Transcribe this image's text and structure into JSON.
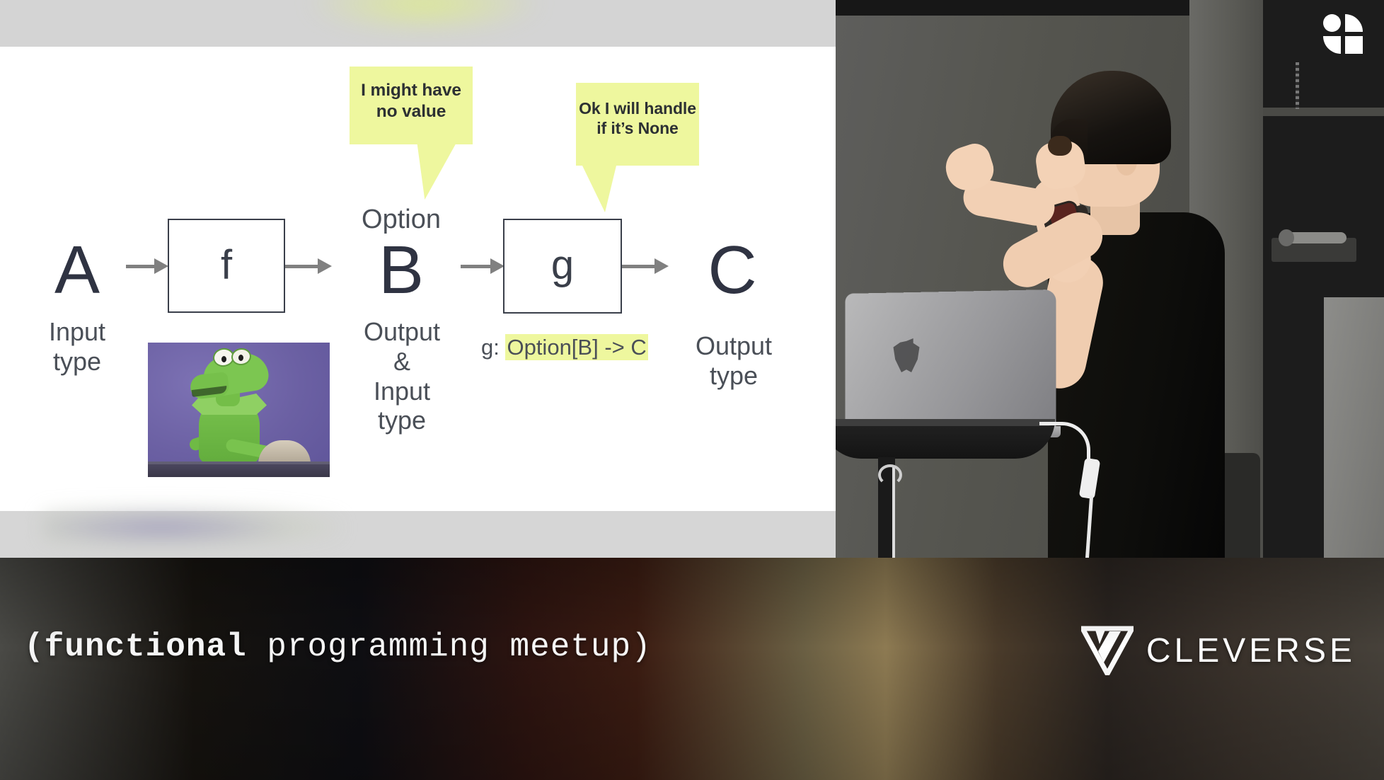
{
  "slide": {
    "bubbles": [
      {
        "id": "bubble-left",
        "text": "I might have no value"
      },
      {
        "id": "bubble-right",
        "text": "Ok I will handle if it’s None"
      }
    ],
    "diagram": {
      "type": "flow",
      "nodes": [
        {
          "id": "A",
          "label": "A",
          "kind": "type",
          "caption": "Input type"
        },
        {
          "id": "f",
          "label": "f",
          "kind": "process",
          "caption": ""
        },
        {
          "id": "B",
          "label": "B",
          "kind": "type",
          "caption": "Output & Input type",
          "prefix": "Option"
        },
        {
          "id": "g",
          "label": "g",
          "kind": "process",
          "caption": ""
        },
        {
          "id": "C",
          "label": "C",
          "kind": "type",
          "caption": "Output type"
        }
      ],
      "edges": [
        {
          "from": "A",
          "to": "f"
        },
        {
          "from": "f",
          "to": "B"
        },
        {
          "from": "B",
          "to": "g"
        },
        {
          "from": "g",
          "to": "C"
        }
      ],
      "captions": {
        "input_type": "Input type",
        "option_prefix": "Option",
        "middle_type": "Output\n&\nInput\ntype",
        "middle_line1": "Output",
        "middle_line2": "&",
        "middle_line3": "Input",
        "middle_line4": "type",
        "output_type": "Output type",
        "output_line1": "Output",
        "output_line2": "type",
        "input_line1": "Input",
        "input_line2": "type"
      },
      "annotation": {
        "prefix": "g: ",
        "highlighted": "Option[B] -> C"
      },
      "letters": {
        "a": "A",
        "b": "B",
        "c": "C",
        "f": "f",
        "g": "g"
      }
    },
    "image": {
      "name": "kermit-the-frog-photo",
      "alt": "Kermit the Frog looking up"
    },
    "colors": {
      "highlight": "#eef79e",
      "ink": "#2f3342",
      "arrow": "#808080",
      "bubble_text": "#2c3033"
    }
  },
  "webcam": {
    "watermark": "quadrant-logo",
    "scene": "speaker presenting beside a laptop"
  },
  "banner": {
    "caption_bold": "(functional",
    "caption_rest": " programming meetup)",
    "caption_full": "(functional programming meetup)",
    "brand": "CLEVERSE"
  }
}
